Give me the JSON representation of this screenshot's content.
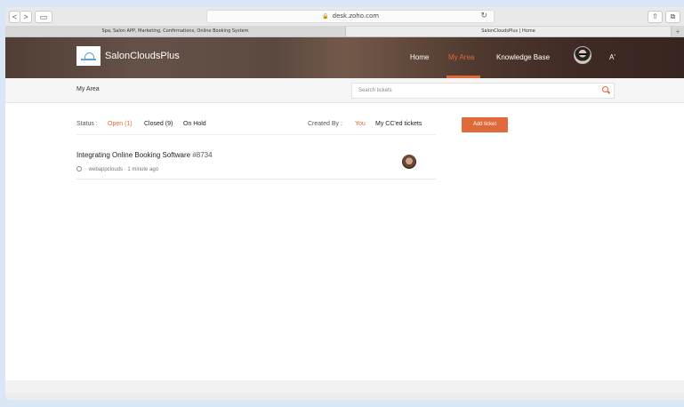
{
  "browser": {
    "back_label": "<",
    "forward_label": ">",
    "sidebar_label": "▭",
    "lock": "🔒",
    "url": "desk.zoho.com",
    "reload": "↻",
    "share_label": "⇧",
    "tabs_label": "⧉",
    "tabs": [
      {
        "label": "Spa, Salon APP, Marketing, Confirmations, Online Booking System"
      },
      {
        "label": "SalonCloudsPlus | Home"
      }
    ],
    "new_tab": "+"
  },
  "header": {
    "brand": "SalonCloudsPlus",
    "nav": {
      "home": "Home",
      "my_area": "My Area",
      "knowledge_base": "Knowledge Base",
      "extra": "A'"
    },
    "accent": "#e0693a"
  },
  "subbar": {
    "title": "My Area",
    "search_placeholder": "Search tickets"
  },
  "filters": {
    "status_label": "Status :",
    "open": "Open (1)",
    "closed": "Closed (9)",
    "on_hold": "On Hold",
    "created_by_label": "Created By :",
    "you": "You",
    "cced": "My CC'ed tickets",
    "add_ticket": "Add ticket"
  },
  "tickets": [
    {
      "title": "Integrating Online Booking Software",
      "id": "#8734",
      "meta": "·  webappclouds  ·  1 minute ago"
    }
  ]
}
